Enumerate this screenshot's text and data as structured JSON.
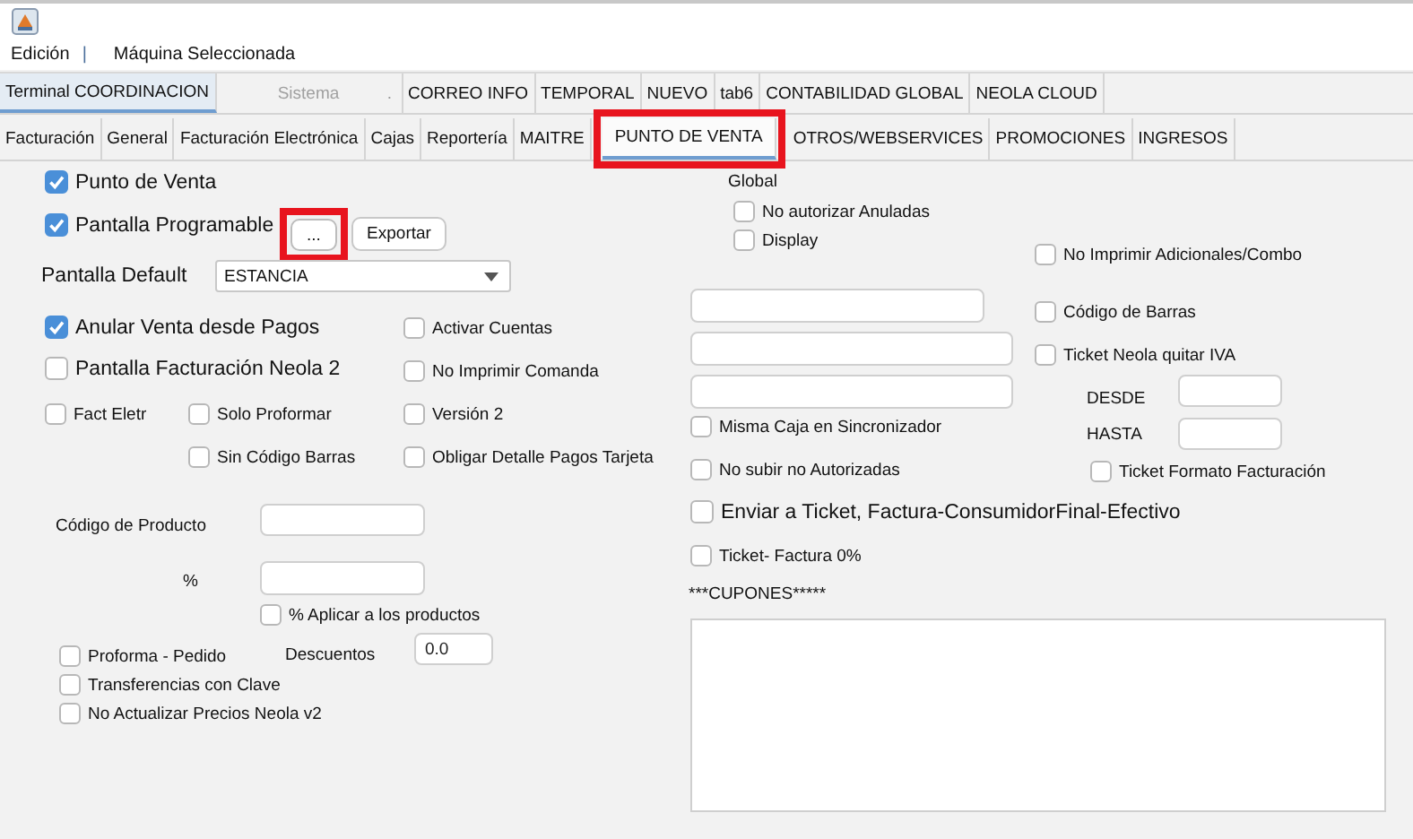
{
  "menu": {
    "items": [
      "Edición",
      "Máquina Seleccionada"
    ],
    "separator": "|"
  },
  "main_tabs": [
    {
      "label": "Terminal COORDINACION",
      "selected": true,
      "disabled": false
    },
    {
      "label": "Sistema",
      "selected": false,
      "disabled": true,
      "suffix": "."
    },
    {
      "label": "CORREO INFO",
      "selected": false,
      "disabled": false
    },
    {
      "label": "TEMPORAL",
      "selected": false,
      "disabled": false
    },
    {
      "label": "NUEVO",
      "selected": false,
      "disabled": false
    },
    {
      "label": "tab6",
      "selected": false,
      "disabled": false
    },
    {
      "label": "CONTABILIDAD GLOBAL",
      "selected": false,
      "disabled": false
    },
    {
      "label": "NEOLA CLOUD",
      "selected": false,
      "disabled": false
    }
  ],
  "sub_tabs": [
    {
      "label": "Facturación",
      "selected": false,
      "highlighted": false
    },
    {
      "label": "General",
      "selected": false,
      "highlighted": false
    },
    {
      "label": "Facturación Electrónica",
      "selected": false,
      "highlighted": false
    },
    {
      "label": "Cajas",
      "selected": false,
      "highlighted": false
    },
    {
      "label": "Reportería",
      "selected": false,
      "highlighted": false
    },
    {
      "label": "MAITRE",
      "selected": false,
      "highlighted": false
    },
    {
      "label": "PUNTO DE VENTA",
      "selected": true,
      "highlighted": true
    },
    {
      "label": "OTROS/WEBSERVICES",
      "selected": false,
      "highlighted": false
    },
    {
      "label": "PROMOCIONES",
      "selected": false,
      "highlighted": false
    },
    {
      "label": "INGRESOS",
      "selected": false,
      "highlighted": false
    }
  ],
  "controls": [
    {
      "kind": "checkbox",
      "label": "Punto de Venta",
      "checked": true
    },
    {
      "kind": "checkbox",
      "label": "Pantalla Programable",
      "checked": true
    },
    {
      "kind": "button",
      "label": "...",
      "highlighted": true
    },
    {
      "kind": "button",
      "label": "Exportar",
      "highlighted": false
    },
    {
      "kind": "label",
      "text": "Pantalla Default"
    },
    {
      "kind": "dropdown",
      "value": "ESTANCIA"
    },
    {
      "kind": "checkbox",
      "label": "Anular Venta desde Pagos",
      "checked": true
    },
    {
      "kind": "checkbox",
      "label": "Pantalla Facturación Neola 2",
      "checked": false
    },
    {
      "kind": "checkbox",
      "label": "Fact Eletr",
      "checked": false
    },
    {
      "kind": "checkbox",
      "label": "Solo Proformar",
      "checked": false
    },
    {
      "kind": "checkbox",
      "label": "Sin Código Barras",
      "checked": false
    },
    {
      "kind": "checkbox",
      "label": "Activar Cuentas",
      "checked": false
    },
    {
      "kind": "checkbox",
      "label": "No Imprimir Comanda",
      "checked": false
    },
    {
      "kind": "checkbox",
      "label": "Versión 2",
      "checked": false
    },
    {
      "kind": "checkbox",
      "label": "Obligar Detalle Pagos Tarjeta",
      "checked": false
    },
    {
      "kind": "label",
      "text": "Código de Producto"
    },
    {
      "kind": "field"
    },
    {
      "kind": "label",
      "text": "%"
    },
    {
      "kind": "field"
    },
    {
      "kind": "checkbox",
      "label": "% Aplicar a los productos",
      "checked": false
    },
    {
      "kind": "checkbox",
      "label": "Proforma - Pedido",
      "checked": false
    },
    {
      "kind": "label",
      "text": "Descuentos"
    },
    {
      "kind": "field",
      "value": "0.0"
    },
    {
      "kind": "checkbox",
      "label": "Transferencias con Clave",
      "checked": false
    },
    {
      "kind": "checkbox",
      "label": "No Actualizar Precios Neola v2",
      "checked": false
    },
    {
      "kind": "label",
      "text": "Global"
    },
    {
      "kind": "checkbox",
      "label": "No autorizar Anuladas",
      "checked": false
    },
    {
      "kind": "checkbox",
      "label": "Display",
      "checked": false
    },
    {
      "kind": "checkbox",
      "label": "No Imprimir Adicionales/Combo",
      "checked": false
    },
    {
      "kind": "field"
    },
    {
      "kind": "field"
    },
    {
      "kind": "field"
    },
    {
      "kind": "checkbox",
      "label": "Misma Caja en Sincronizador",
      "checked": false
    },
    {
      "kind": "checkbox",
      "label": "No subir no Autorizadas",
      "checked": false
    },
    {
      "kind": "checkbox",
      "label": "Enviar a Ticket, Factura-ConsumidorFinal-Efectivo",
      "checked": false
    },
    {
      "kind": "checkbox",
      "label": "Ticket- Factura 0%",
      "checked": false
    },
    {
      "kind": "checkbox",
      "label": "Código de Barras",
      "checked": false
    },
    {
      "kind": "checkbox",
      "label": "Ticket Neola quitar IVA",
      "checked": false
    },
    {
      "kind": "label",
      "text": "DESDE"
    },
    {
      "kind": "field"
    },
    {
      "kind": "label",
      "text": "HASTA"
    },
    {
      "kind": "field"
    },
    {
      "kind": "checkbox",
      "label": "Ticket Formato Facturación",
      "checked": false
    },
    {
      "kind": "label",
      "text": "***CUPONES*****"
    },
    {
      "kind": "text_area"
    }
  ]
}
